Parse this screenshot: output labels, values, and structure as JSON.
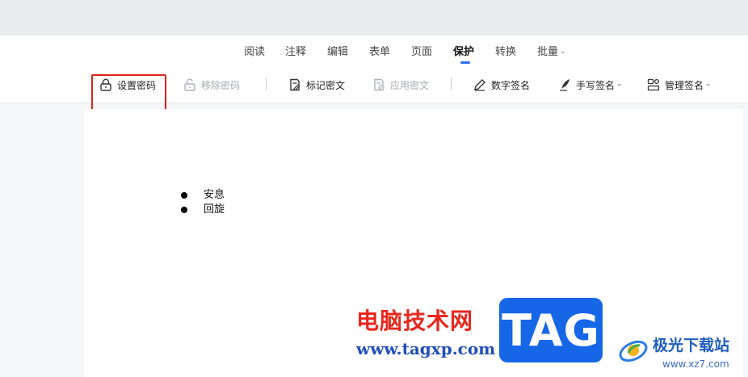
{
  "tabs": [
    {
      "label": "阅读"
    },
    {
      "label": "注释"
    },
    {
      "label": "编辑"
    },
    {
      "label": "表单"
    },
    {
      "label": "页面"
    },
    {
      "label": "保护",
      "active": true
    },
    {
      "label": "转换"
    },
    {
      "label": "批量",
      "has_dropdown": true
    }
  ],
  "toolbar": {
    "set_password": {
      "label": "设置密码",
      "icon": "lock-icon",
      "enabled": true
    },
    "remove_password": {
      "label": "移除密码",
      "icon": "unlock-icon",
      "enabled": false
    },
    "mark_redaction": {
      "label": "标记密文",
      "icon": "mark-redaction-icon",
      "enabled": true
    },
    "apply_redaction": {
      "label": "应用密文",
      "icon": "apply-redaction-icon",
      "enabled": false
    },
    "digital_signature": {
      "label": "数字签名",
      "icon": "pen-icon",
      "enabled": true
    },
    "handwritten_signature": {
      "label": "手写签名",
      "icon": "quill-icon",
      "enabled": true,
      "has_dropdown": true
    },
    "manage_signature": {
      "label": "管理签名",
      "icon": "manage-signature-icon",
      "enabled": true,
      "has_dropdown": true
    }
  },
  "document": {
    "bullets": [
      "安息",
      "回旋"
    ]
  },
  "watermark": {
    "site_cn": "电脑技术网",
    "site_url": "www.tagxp.com",
    "tag": "TAG",
    "brand_cn": "极光下载站",
    "brand_url": "www.xz7.com"
  },
  "colors": {
    "accent": "#2f6ff0",
    "highlight_box": "#d9231b",
    "disabled_text": "#a8abb0"
  }
}
